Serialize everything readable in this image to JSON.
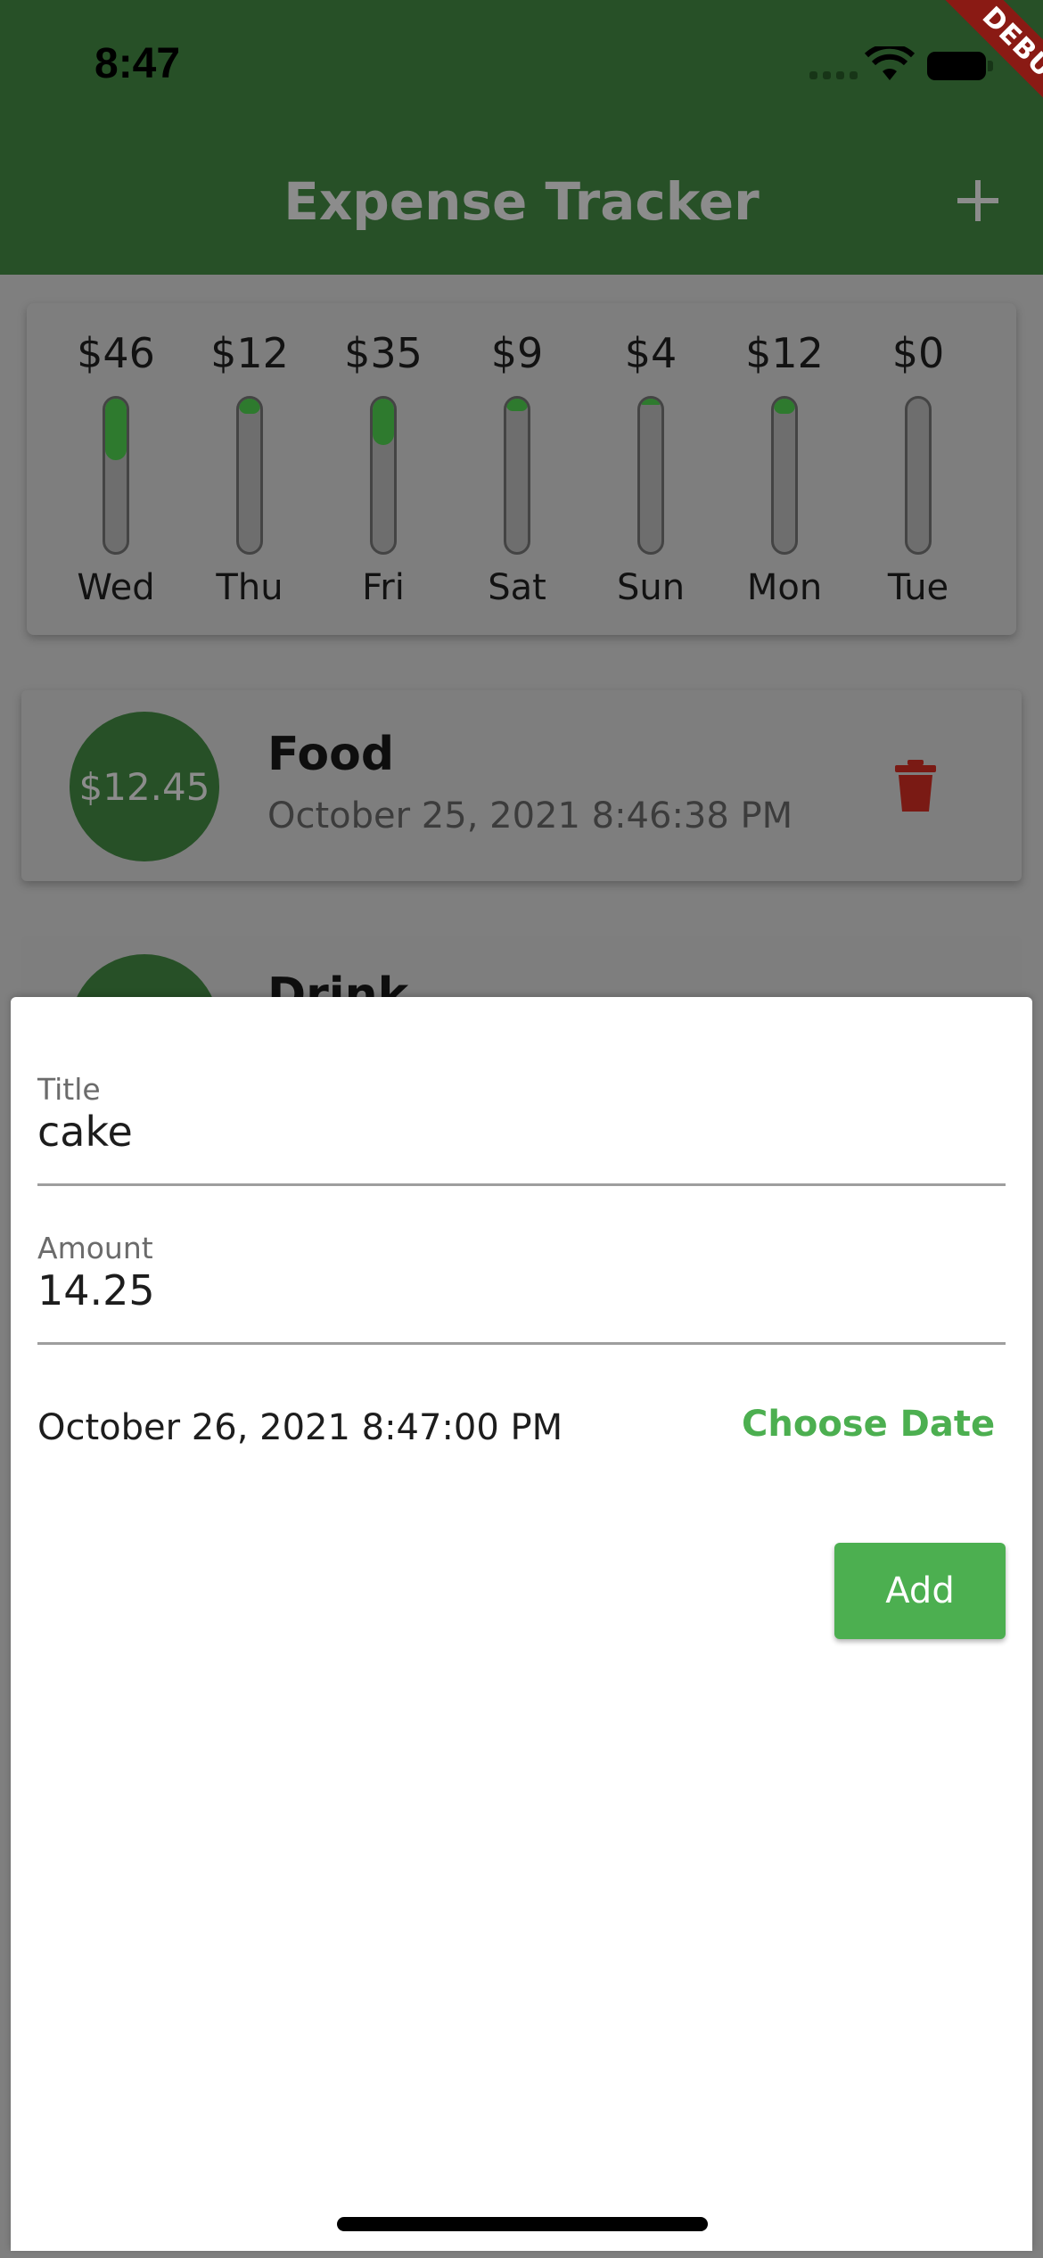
{
  "status_bar": {
    "time": "8:47"
  },
  "debug_banner": "DEBUG",
  "app_bar": {
    "title": "Expense Tracker",
    "add_icon": "plus-icon"
  },
  "chart": {
    "days": [
      {
        "amount": "$46",
        "day": "Wed",
        "fill_fraction": 0.4
      },
      {
        "amount": "$12",
        "day": "Thu",
        "fill_fraction": 0.1
      },
      {
        "amount": "$35",
        "day": "Fri",
        "fill_fraction": 0.3
      },
      {
        "amount": "$9",
        "day": "Sat",
        "fill_fraction": 0.08
      },
      {
        "amount": "$4",
        "day": "Sun",
        "fill_fraction": 0.04
      },
      {
        "amount": "$12",
        "day": "Mon",
        "fill_fraction": 0.1
      },
      {
        "amount": "$0",
        "day": "Tue",
        "fill_fraction": 0.0
      }
    ],
    "fill_color": "#2e7a2e"
  },
  "transactions": [
    {
      "amount": "$12.45",
      "title": "Food",
      "date": "October 25, 2021 8:46:38 PM",
      "delete_icon": "trash-icon"
    },
    {
      "amount": "",
      "title": "Drink",
      "date": ""
    }
  ],
  "new_transaction": {
    "title_label": "Title",
    "title_value": "cake",
    "amount_label": "Amount",
    "amount_value": "14.25",
    "chosen_date": "October 26, 2021 8:47:00 PM",
    "choose_date_label": "Choose Date",
    "add_label": "Add"
  },
  "colors": {
    "primary": "#275027",
    "accent": "#4caf50",
    "danger": "#8a1a14"
  }
}
